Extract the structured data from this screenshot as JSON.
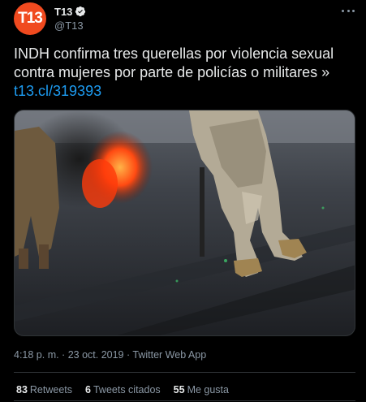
{
  "author": {
    "display_name": "T13",
    "handle": "@T13",
    "avatar_logo": "T13",
    "verified": true
  },
  "tweet": {
    "text": "INDH confirma tres querellas por violencia sexual contra mujeres por parte de policías o militares »",
    "link": "t13.cl/319393"
  },
  "meta": {
    "timestamp": "4:18 p. m. · 23 oct. 2019 · Twitter Web App"
  },
  "stats": {
    "retweets": {
      "count": "83",
      "label": "Retweets"
    },
    "quotes": {
      "count": "6",
      "label": "Tweets citados"
    },
    "likes": {
      "count": "55",
      "label": "Me gusta"
    }
  },
  "colors": {
    "background": "#000000",
    "accent_link": "#1d9bf0",
    "avatar": "#f04a1f"
  },
  "icons": {
    "verified": "verified-badge-icon",
    "more": "more-options-icon"
  }
}
